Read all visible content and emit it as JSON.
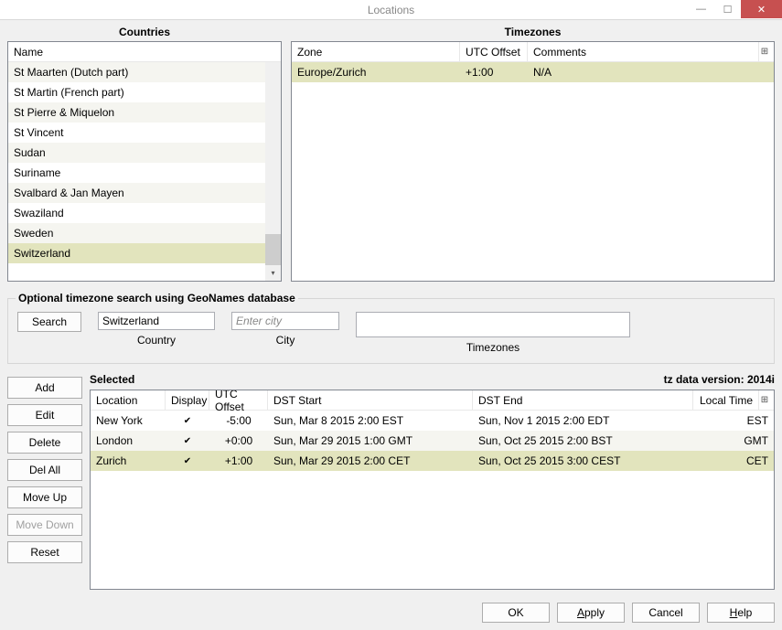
{
  "window_title": "Locations",
  "panels": {
    "countries_title": "Countries",
    "timezones_title": "Timezones"
  },
  "countries": {
    "header": "Name",
    "items": [
      {
        "name": "St Maarten (Dutch part)"
      },
      {
        "name": "St Martin (French part)"
      },
      {
        "name": "St Pierre & Miquelon"
      },
      {
        "name": "St Vincent"
      },
      {
        "name": "Sudan"
      },
      {
        "name": "Suriname"
      },
      {
        "name": "Svalbard & Jan Mayen"
      },
      {
        "name": "Swaziland"
      },
      {
        "name": "Sweden"
      },
      {
        "name": "Switzerland",
        "selected": true
      }
    ]
  },
  "timezones": {
    "headers": {
      "zone": "Zone",
      "offset": "UTC Offset",
      "comments": "Comments"
    },
    "items": [
      {
        "zone": "Europe/Zurich",
        "offset": "+1:00",
        "comments": "N/A",
        "selected": true
      }
    ]
  },
  "search_box": {
    "legend": "Optional timezone search using GeoNames database",
    "search_btn": "Search",
    "country_label": "Country",
    "country_value": "Switzerland",
    "city_label": "City",
    "city_placeholder": "Enter city",
    "tz_label": "Timezones"
  },
  "side_buttons": {
    "add": "Add",
    "edit": "Edit",
    "delete": "Delete",
    "del_all": "Del All",
    "move_up": "Move Up",
    "move_down": "Move Down",
    "reset": "Reset"
  },
  "selected": {
    "title": "Selected",
    "tz_version": "tz data version: 2014i",
    "headers": {
      "location": "Location",
      "display": "Display",
      "offset": "UTC Offset",
      "dst_start": "DST Start",
      "dst_end": "DST End",
      "local_time": "Local Time"
    },
    "rows": [
      {
        "location": "New York",
        "display": true,
        "offset": "-5:00",
        "dst_start": "Sun, Mar 8 2015 2:00 EST",
        "dst_end": "Sun, Nov 1 2015 2:00 EDT",
        "local_time": "EST"
      },
      {
        "location": "London",
        "display": true,
        "offset": "+0:00",
        "dst_start": "Sun, Mar 29 2015 1:00 GMT",
        "dst_end": "Sun, Oct 25 2015 2:00 BST",
        "local_time": "GMT"
      },
      {
        "location": "Zurich",
        "display": true,
        "offset": "+1:00",
        "dst_start": "Sun, Mar 29 2015 2:00 CET",
        "dst_end": "Sun, Oct 25 2015 3:00 CEST",
        "local_time": "CET",
        "selected": true
      }
    ]
  },
  "dialog_buttons": {
    "ok": "OK",
    "apply": "Apply",
    "cancel": "Cancel",
    "help": "Help"
  }
}
